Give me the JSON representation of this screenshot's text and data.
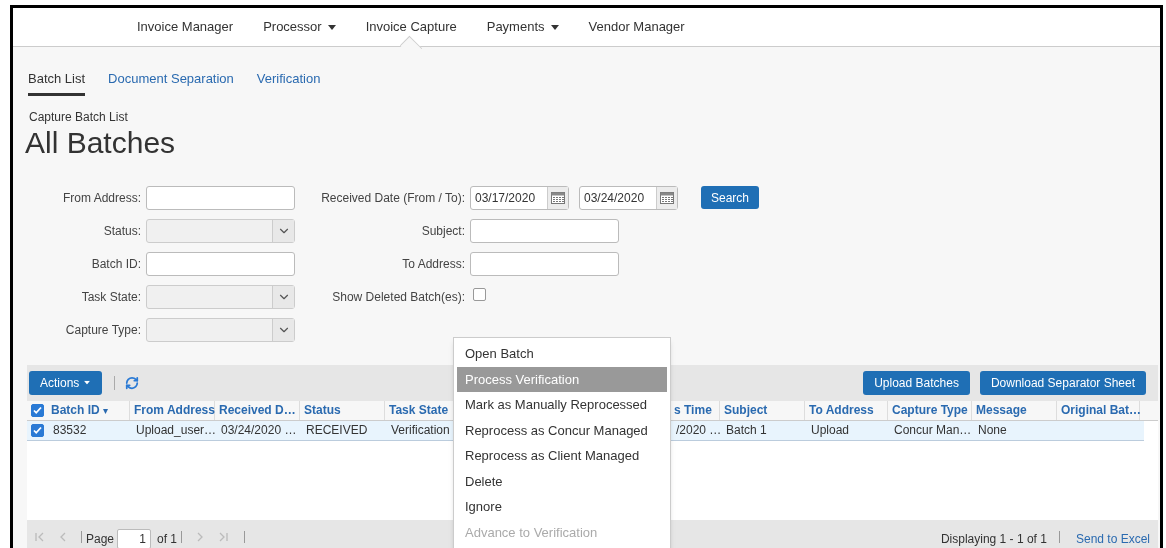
{
  "nav": [
    {
      "label": "Invoice Manager",
      "dropdown": false,
      "selected": false
    },
    {
      "label": "Processor",
      "dropdown": true,
      "selected": false
    },
    {
      "label": "Invoice Capture",
      "dropdown": false,
      "selected": true
    },
    {
      "label": "Payments",
      "dropdown": true,
      "selected": false
    },
    {
      "label": "Vendor Manager",
      "dropdown": false,
      "selected": false
    }
  ],
  "subtabs": [
    {
      "label": "Batch List",
      "selected": true
    },
    {
      "label": "Document Separation",
      "selected": false
    },
    {
      "label": "Verification",
      "selected": false
    }
  ],
  "page": {
    "breadcrumb": "Capture Batch List",
    "title": "All Batches"
  },
  "form": {
    "left": [
      {
        "label": "From Address:",
        "kind": "text"
      },
      {
        "label": "Status:",
        "kind": "select"
      },
      {
        "label": "Batch ID:",
        "kind": "text"
      },
      {
        "label": "Task State:",
        "kind": "select"
      },
      {
        "label": "Capture Type:",
        "kind": "select"
      }
    ],
    "right": [
      {
        "label": "Received Date (From / To):",
        "kind": "date_range",
        "values": [
          "03/17/2020",
          "03/24/2020"
        ]
      },
      {
        "label": "Subject:",
        "kind": "text"
      },
      {
        "label": "To Address:",
        "kind": "text"
      },
      {
        "label": "Show Deleted Batch(es):",
        "kind": "checkbox",
        "checked": false
      }
    ],
    "search_button": "Search"
  },
  "toolbar": {
    "actions": "Actions",
    "buttons": [
      "Upload Batches",
      "Download Separator Sheet"
    ]
  },
  "table": {
    "all_checked": true,
    "columns": [
      {
        "label": "Batch ID",
        "sort_indicator": "▾"
      },
      {
        "label": "From Address"
      },
      {
        "label": "Received D…"
      },
      {
        "label": "Status"
      },
      {
        "label": "Task State"
      },
      {
        "label": "s Time"
      },
      {
        "label": "Subject"
      },
      {
        "label": "To Address"
      },
      {
        "label": "Capture Type"
      },
      {
        "label": "Message"
      },
      {
        "label": "Original Bat…"
      }
    ],
    "rows": [
      {
        "checked": true,
        "cells": [
          "83532",
          "Upload_user…",
          "03/24/2020 …",
          "RECEIVED",
          "Verification",
          "/2020 …",
          "Batch 1",
          "Upload",
          "Concur Man…",
          "None",
          ""
        ]
      }
    ]
  },
  "pager": {
    "page_label": "Page",
    "page": "1",
    "of": "of 1",
    "displaying": "Displaying 1 - 1 of 1",
    "export": "Send to Excel"
  },
  "menu": [
    {
      "label": "Open Batch",
      "selected": false,
      "disabled": false
    },
    {
      "label": "Process Verification",
      "selected": true,
      "disabled": false
    },
    {
      "label": "Mark as Manually Reprocessed",
      "selected": false,
      "disabled": false
    },
    {
      "label": "Reprocess as Concur Managed",
      "selected": false,
      "disabled": false
    },
    {
      "label": "Reprocess as Client Managed",
      "selected": false,
      "disabled": false
    },
    {
      "label": "Delete",
      "selected": false,
      "disabled": false
    },
    {
      "label": "Ignore",
      "selected": false,
      "disabled": false
    },
    {
      "label": "Advance to Verification",
      "selected": false,
      "disabled": true
    }
  ]
}
